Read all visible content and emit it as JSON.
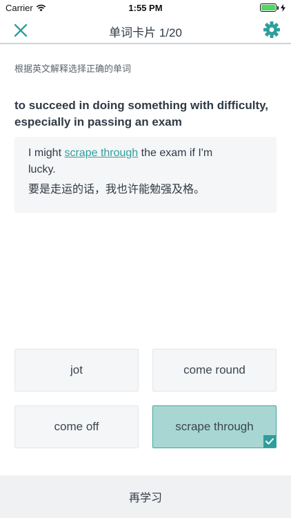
{
  "status": {
    "carrier": "Carrier",
    "time": "1:55 PM"
  },
  "nav": {
    "title": "单词卡片 1/20",
    "close_icon": "close-icon",
    "settings_icon": "gear-icon"
  },
  "instruction": "根据英文解释选择正确的单词",
  "definition": "to succeed in doing something with difficulty, especially in passing an exam",
  "example": {
    "en_before": "I might ",
    "en_highlight": "scrape through",
    "en_after": " the exam if I'm lucky.",
    "zh": "要是走运的话，我也许能勉强及格。"
  },
  "options": [
    {
      "label": "jot"
    },
    {
      "label": "come round"
    },
    {
      "label": "come off"
    },
    {
      "label": "scrape through",
      "selected": true
    }
  ],
  "bottom": {
    "label": "再学习"
  },
  "colors": {
    "accent": "#2f9e9b",
    "selected_bg": "#a8d7d3",
    "battery": "#4cd964"
  }
}
